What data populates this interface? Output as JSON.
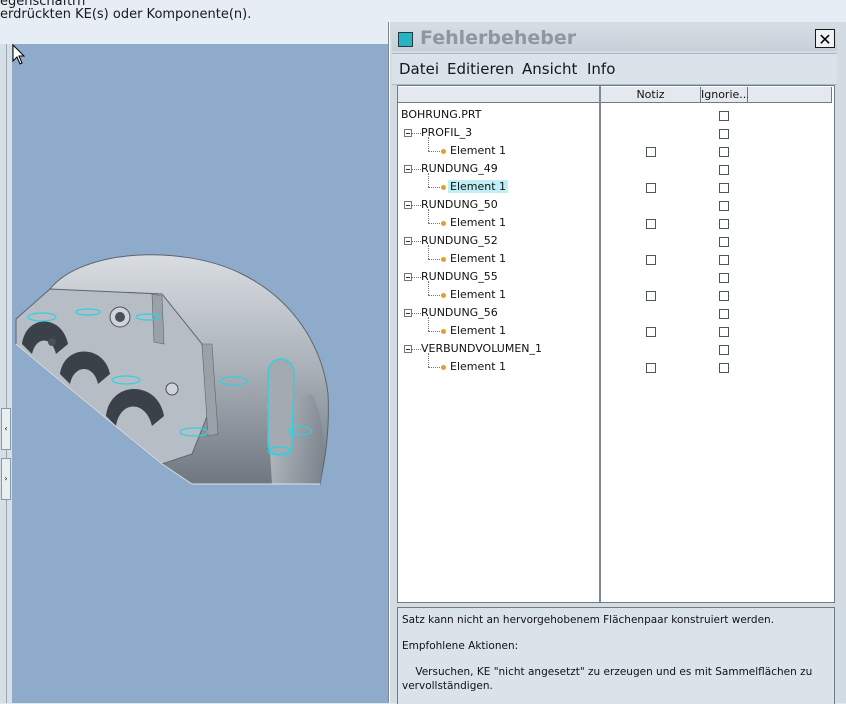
{
  "message_area": {
    "line1": "egenschaftrn",
    "line2": "erdrückten KE(s) oder Komponente(n)."
  },
  "left_strip": {
    "handle_top": "‹",
    "handle_bottom": "›"
  },
  "dialog": {
    "title": "Fehlerbeheber",
    "close_label": "✕",
    "menu": [
      "Datei",
      "Editieren",
      "Ansicht",
      "Info"
    ],
    "columns": {
      "tree": "",
      "notiz": "Notiz",
      "ignore": "Ignorie..."
    },
    "tree": {
      "root": "BOHRUNG.PRT",
      "features": [
        {
          "name": "PROFIL_3",
          "element": "Element 1"
        },
        {
          "name": "RUNDUNG_49",
          "element": "Element 1",
          "selected": true
        },
        {
          "name": "RUNDUNG_50",
          "element": "Element 1"
        },
        {
          "name": "RUNDUNG_52",
          "element": "Element 1"
        },
        {
          "name": "RUNDUNG_55",
          "element": "Element 1"
        },
        {
          "name": "RUNDUNG_56",
          "element": "Element 1"
        },
        {
          "name": "VERBUNDVOLUMEN_1",
          "element": "Element 1"
        }
      ]
    },
    "info": {
      "line1": "Satz kann nicht an hervorgehobenem Flächenpaar konstruiert werden.",
      "line2": "Empfohlene Aktionen:",
      "line3": "    Versuchen, KE \"nicht angesetzt\" zu erzeugen und es mit Sammelflächen zu",
      "line4": "vervollständigen."
    }
  },
  "colors": {
    "viewport_bg": "#8fabcb",
    "highlight_edges": "#2fd0e0",
    "selection": "#bfeff5"
  },
  "icons": [
    "close-icon",
    "window-icon",
    "expand-icon",
    "feature-dot-icon",
    "mouse-cursor-icon"
  ]
}
